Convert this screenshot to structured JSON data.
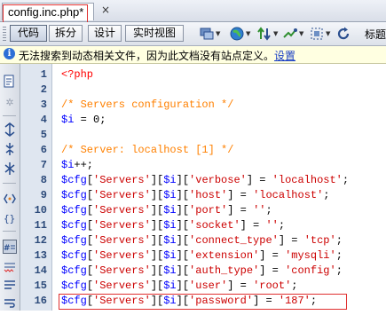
{
  "document_tab": {
    "title": "config.inc.php*",
    "close_glyph": "×"
  },
  "toolbar": {
    "code_label": "代码",
    "split_label": "拆分",
    "design_label": "设计",
    "live_view_label": "实时视图",
    "title_label": "标题"
  },
  "info_bar": {
    "message": "无法搜索到动态相关文件，因为此文档没有站点定义。",
    "link": "设置"
  },
  "colors": {
    "php_tag": "#ff0000",
    "comment": "#ff8000",
    "variable": "#0000ff",
    "string": "#cc0000",
    "gutter": "#dfe6f0",
    "highlight_box": "#e03030"
  },
  "editor": {
    "line_numbers": [
      "1",
      "2",
      "3",
      "4",
      "5",
      "6",
      "7",
      "8",
      "9",
      "10",
      "11",
      "12",
      "13",
      "14",
      "15",
      "16"
    ],
    "lines": [
      {
        "tokens": [
          {
            "t": "<?php",
            "k": "tag"
          }
        ]
      },
      {
        "tokens": []
      },
      {
        "tokens": [
          {
            "t": "/* Servers configuration */",
            "k": "comment"
          }
        ]
      },
      {
        "tokens": [
          {
            "t": "$i",
            "k": "var"
          },
          {
            "t": " = 0;",
            "k": "default"
          }
        ]
      },
      {
        "tokens": []
      },
      {
        "tokens": [
          {
            "t": "/* Server: localhost [1] */",
            "k": "comment"
          }
        ]
      },
      {
        "tokens": [
          {
            "t": "$i",
            "k": "var"
          },
          {
            "t": "++;",
            "k": "default"
          }
        ]
      },
      {
        "tokens": [
          {
            "t": "$cfg",
            "k": "var"
          },
          {
            "t": "[",
            "k": "default"
          },
          {
            "t": "'Servers'",
            "k": "string"
          },
          {
            "t": "][",
            "k": "default"
          },
          {
            "t": "$i",
            "k": "var"
          },
          {
            "t": "][",
            "k": "default"
          },
          {
            "t": "'verbose'",
            "k": "string"
          },
          {
            "t": "] = ",
            "k": "default"
          },
          {
            "t": "'localhost'",
            "k": "string"
          },
          {
            "t": ";",
            "k": "default"
          }
        ]
      },
      {
        "tokens": [
          {
            "t": "$cfg",
            "k": "var"
          },
          {
            "t": "[",
            "k": "default"
          },
          {
            "t": "'Servers'",
            "k": "string"
          },
          {
            "t": "][",
            "k": "default"
          },
          {
            "t": "$i",
            "k": "var"
          },
          {
            "t": "][",
            "k": "default"
          },
          {
            "t": "'host'",
            "k": "string"
          },
          {
            "t": "] = ",
            "k": "default"
          },
          {
            "t": "'localhost'",
            "k": "string"
          },
          {
            "t": ";",
            "k": "default"
          }
        ]
      },
      {
        "tokens": [
          {
            "t": "$cfg",
            "k": "var"
          },
          {
            "t": "[",
            "k": "default"
          },
          {
            "t": "'Servers'",
            "k": "string"
          },
          {
            "t": "][",
            "k": "default"
          },
          {
            "t": "$i",
            "k": "var"
          },
          {
            "t": "][",
            "k": "default"
          },
          {
            "t": "'port'",
            "k": "string"
          },
          {
            "t": "] = ",
            "k": "default"
          },
          {
            "t": "''",
            "k": "string"
          },
          {
            "t": ";",
            "k": "default"
          }
        ]
      },
      {
        "tokens": [
          {
            "t": "$cfg",
            "k": "var"
          },
          {
            "t": "[",
            "k": "default"
          },
          {
            "t": "'Servers'",
            "k": "string"
          },
          {
            "t": "][",
            "k": "default"
          },
          {
            "t": "$i",
            "k": "var"
          },
          {
            "t": "][",
            "k": "default"
          },
          {
            "t": "'socket'",
            "k": "string"
          },
          {
            "t": "] = ",
            "k": "default"
          },
          {
            "t": "''",
            "k": "string"
          },
          {
            "t": ";",
            "k": "default"
          }
        ]
      },
      {
        "tokens": [
          {
            "t": "$cfg",
            "k": "var"
          },
          {
            "t": "[",
            "k": "default"
          },
          {
            "t": "'Servers'",
            "k": "string"
          },
          {
            "t": "][",
            "k": "default"
          },
          {
            "t": "$i",
            "k": "var"
          },
          {
            "t": "][",
            "k": "default"
          },
          {
            "t": "'connect_type'",
            "k": "string"
          },
          {
            "t": "] = ",
            "k": "default"
          },
          {
            "t": "'tcp'",
            "k": "string"
          },
          {
            "t": ";",
            "k": "default"
          }
        ]
      },
      {
        "tokens": [
          {
            "t": "$cfg",
            "k": "var"
          },
          {
            "t": "[",
            "k": "default"
          },
          {
            "t": "'Servers'",
            "k": "string"
          },
          {
            "t": "][",
            "k": "default"
          },
          {
            "t": "$i",
            "k": "var"
          },
          {
            "t": "][",
            "k": "default"
          },
          {
            "t": "'extension'",
            "k": "string"
          },
          {
            "t": "] = ",
            "k": "default"
          },
          {
            "t": "'mysqli'",
            "k": "string"
          },
          {
            "t": ";",
            "k": "default"
          }
        ]
      },
      {
        "tokens": [
          {
            "t": "$cfg",
            "k": "var"
          },
          {
            "t": "[",
            "k": "default"
          },
          {
            "t": "'Servers'",
            "k": "string"
          },
          {
            "t": "][",
            "k": "default"
          },
          {
            "t": "$i",
            "k": "var"
          },
          {
            "t": "][",
            "k": "default"
          },
          {
            "t": "'auth_type'",
            "k": "string"
          },
          {
            "t": "] = ",
            "k": "default"
          },
          {
            "t": "'config'",
            "k": "string"
          },
          {
            "t": ";",
            "k": "default"
          }
        ]
      },
      {
        "tokens": [
          {
            "t": "$cfg",
            "k": "var"
          },
          {
            "t": "[",
            "k": "default"
          },
          {
            "t": "'Servers'",
            "k": "string"
          },
          {
            "t": "][",
            "k": "default"
          },
          {
            "t": "$i",
            "k": "var"
          },
          {
            "t": "][",
            "k": "default"
          },
          {
            "t": "'user'",
            "k": "string"
          },
          {
            "t": "] = ",
            "k": "default"
          },
          {
            "t": "'root'",
            "k": "string"
          },
          {
            "t": ";",
            "k": "default"
          }
        ]
      },
      {
        "tokens": [
          {
            "t": "$cfg",
            "k": "var"
          },
          {
            "t": "[",
            "k": "default"
          },
          {
            "t": "'Servers'",
            "k": "string"
          },
          {
            "t": "][",
            "k": "default"
          },
          {
            "t": "$i",
            "k": "var"
          },
          {
            "t": "][",
            "k": "default"
          },
          {
            "t": "'password'",
            "k": "string"
          },
          {
            "t": "] = ",
            "k": "default"
          },
          {
            "t": "'187'",
            "k": "string"
          },
          {
            "t": ";",
            "k": "default"
          }
        ]
      }
    ]
  }
}
